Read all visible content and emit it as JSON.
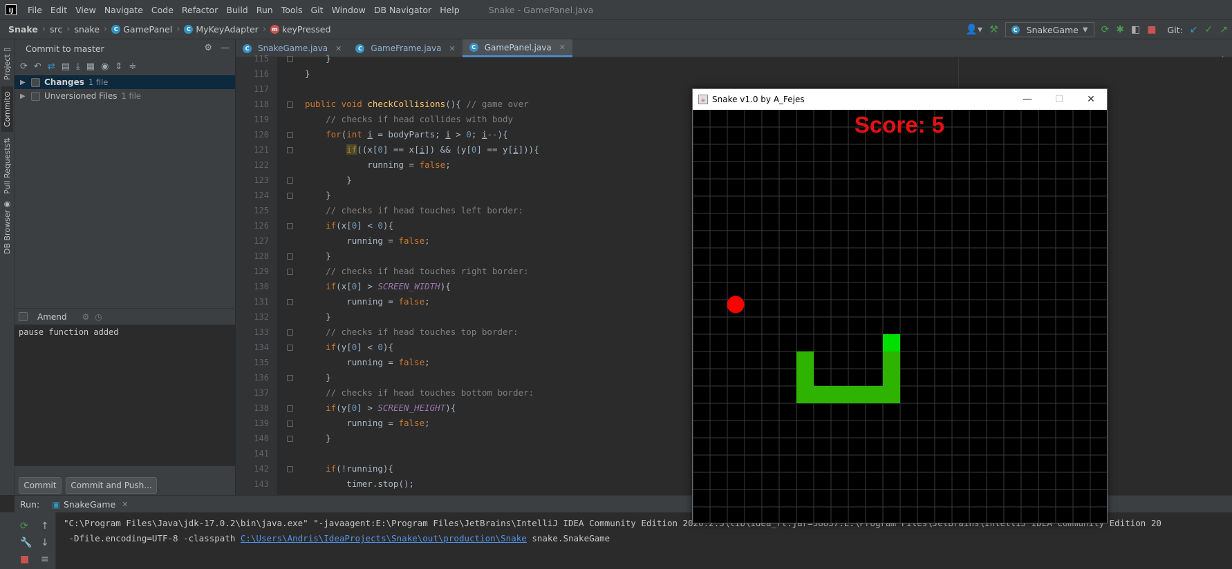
{
  "menubar": {
    "items": [
      "File",
      "Edit",
      "View",
      "Navigate",
      "Code",
      "Refactor",
      "Build",
      "Run",
      "Tools",
      "Git",
      "Window",
      "DB Navigator",
      "Help"
    ],
    "window_title": "Snake - GamePanel.java"
  },
  "breadcrumb": {
    "project": "Snake",
    "src": "src",
    "package": "snake",
    "class": "GamePanel",
    "inner_class": "MyKeyAdapter",
    "method": "keyPressed"
  },
  "toolbar": {
    "run_config": "SnakeGame",
    "git_label": "Git:"
  },
  "left_stripe": {
    "project": "Project",
    "commit": "Commit",
    "pull_requests": "Pull Requests",
    "db_browser": "DB Browser"
  },
  "commit_panel": {
    "title": "Commit to master",
    "changes_label": "Changes",
    "changes_count": "1 file",
    "unversioned_label": "Unversioned Files",
    "unversioned_count": "1 file",
    "amend_label": "Amend",
    "message": "pause function added",
    "commit_button": "Commit",
    "commit_push_button": "Commit and Push..."
  },
  "editor": {
    "tabs": [
      {
        "label": "SnakeGame.java",
        "active": false
      },
      {
        "label": "GameFrame.java",
        "active": false
      },
      {
        "label": "GamePanel.java",
        "active": true
      }
    ],
    "line_numbers": [
      "115",
      "116",
      "117",
      "118",
      "119",
      "120",
      "121",
      "122",
      "123",
      "124",
      "125",
      "126",
      "127",
      "128",
      "129",
      "130",
      "131",
      "132",
      "133",
      "134",
      "135",
      "136",
      "137",
      "138",
      "139",
      "140",
      "141",
      "142",
      "143"
    ]
  },
  "run_panel": {
    "label": "Run:",
    "tab": "SnakeGame",
    "console_line1": "\"C:\\Program Files\\Java\\jdk-17.0.2\\bin\\java.exe\" \"-javaagent:E:\\Program Files\\JetBrains\\IntelliJ IDEA Community Edition 2020.2.3\\lib\\idea_rt.jar=58837:E:\\Program Files\\JetBrains\\IntelliJ IDEA Community Edition 20",
    "console_line2_prefix": " -Dfile.encoding=UTF-8 -classpath ",
    "console_link": "C:\\Users\\Andris\\IdeaProjects\\Snake\\out\\production\\Snake",
    "console_line2_suffix": " snake.SnakeGame"
  },
  "game_window": {
    "title": "Snake v1.0 by A_Fejes",
    "score_text": "Score: 5",
    "score": 5,
    "colors": {
      "score": "#e81010",
      "apple": "#ff0000",
      "snake_head": "#00e000",
      "snake_body": "#2db300",
      "grid": "#3a3a3a"
    }
  }
}
